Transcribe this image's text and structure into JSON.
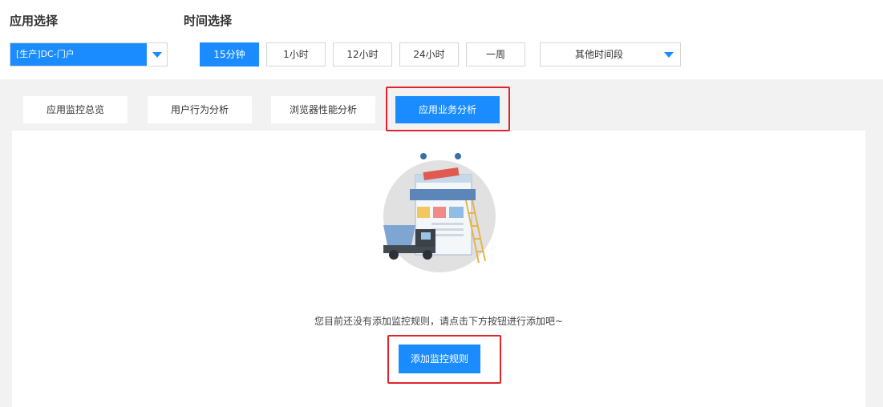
{
  "app_select": {
    "label": "应用选择",
    "value": "[生产]DC-门户"
  },
  "time_select": {
    "label": "时间选择",
    "options": [
      "15分钟",
      "1小时",
      "12小时",
      "24小时",
      "一周"
    ],
    "active": "15分钟",
    "other_range": "其他时间段"
  },
  "tabs": [
    {
      "label": "应用监控总览",
      "active": false
    },
    {
      "label": "用户行为分析",
      "active": false
    },
    {
      "label": "浏览器性能分析",
      "active": false
    },
    {
      "label": "应用业务分析",
      "active": true
    }
  ],
  "empty_state": {
    "message": "您目前还没有添加监控规则，请点击下方按钮进行添加吧~",
    "button": "添加监控规则"
  },
  "colors": {
    "accent": "#1a8cff",
    "highlight": "#e0242b",
    "page_bg": "#f2f2f2"
  }
}
